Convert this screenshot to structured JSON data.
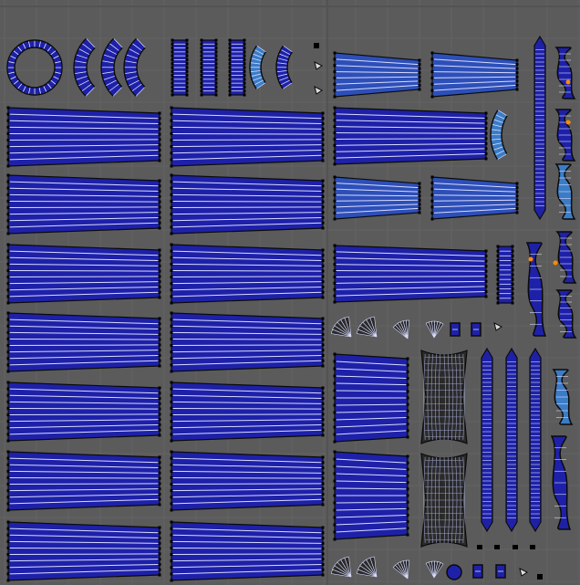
{
  "editor": {
    "type": "uv-layout-viewport",
    "background": "#5b5b5b",
    "grid_minor": "#636363",
    "grid_major": "#535353"
  },
  "colors": {
    "face_fill": "#1e21a8",
    "face_fill_light": "#2d4fb8",
    "face_fill_selected": "#3b7cc6",
    "edge": "#0a0a0a",
    "edge_highlight": "#d8dcff",
    "vertex": "#000000",
    "vertex_selected": "#ff8a00"
  },
  "layout_summary": {
    "large_taper_strips": 14,
    "medium_taper_strips": 8,
    "ring_islands": 1,
    "barrel_islands": 2
  }
}
